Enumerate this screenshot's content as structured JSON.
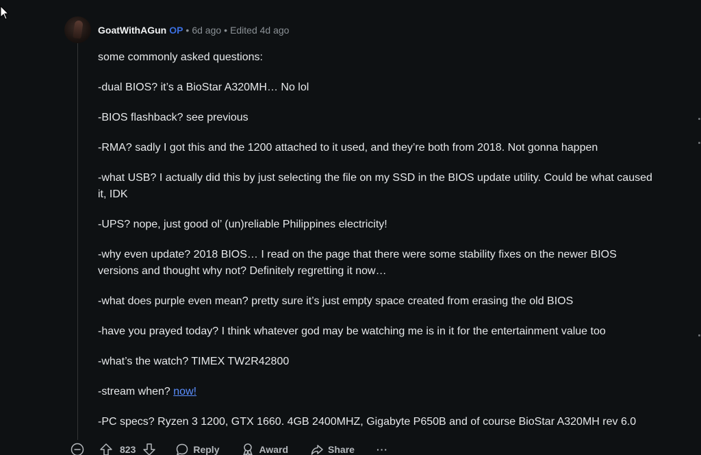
{
  "comment": {
    "author": "GoatWithAGun",
    "op_badge": "OP",
    "separator1": "•",
    "posted": "6d ago",
    "separator2": "•",
    "edited": "Edited 4d ago",
    "paragraphs": [
      "some commonly asked questions:",
      "-dual BIOS? it’s a BioStar A320MH… No lol",
      "-BIOS flashback? see previous",
      "-RMA? sadly I got this and the 1200 attached to it used, and they’re both from 2018. Not gonna happen",
      "-what USB? I actually did this by just selecting the file on my SSD in the BIOS update utility. Could be what caused it, IDK",
      "-UPS? nope, just good ol’ (un)reliable Philippines electricity!",
      "-why even update? 2018 BIOS… I read on the page that there were some stability fixes on the newer BIOS versions and thought why not? Definitely regretting it now…",
      "-what does purple even mean? pretty sure it’s just empty space created from erasing the old BIOS",
      "-have you prayed today? I think whatever god may be watching me is in it for the entertainment value too",
      "-what’s the watch? TIMEX TW2R42800"
    ],
    "stream_prefix": "-stream when? ",
    "stream_link": "now!",
    "specs": "-PC specs? Ryzen 3 1200, GTX 1660. 4GB 2400MHZ, Gigabyte P650B and of course BioStar A320MH rev 6.0"
  },
  "actions": {
    "score": "823",
    "reply": "Reply",
    "award": "Award",
    "share": "Share",
    "more": "···"
  },
  "icons": {
    "collapse": "minus-circle-icon",
    "upvote": "arrow-up-icon",
    "downvote": "arrow-down-icon",
    "reply": "speech-bubble-icon",
    "award": "award-icon",
    "share": "share-arrow-icon",
    "cursor": "mouse-pointer-icon"
  }
}
